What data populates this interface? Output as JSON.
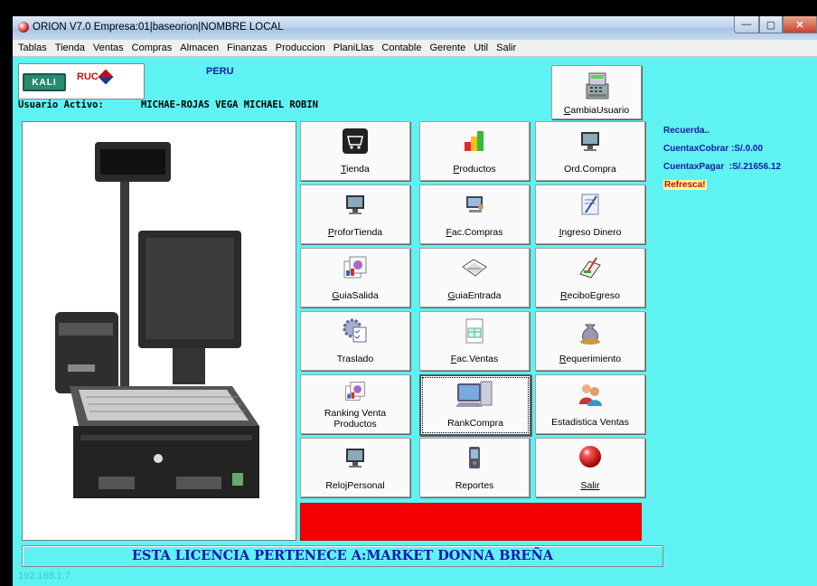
{
  "window": {
    "title": "ORION V7.0 Empresa:01|baseorion|NOMBRE LOCAL"
  },
  "menu": [
    "Tablas",
    "Tienda",
    "Ventas",
    "Compras",
    "Almacen",
    "Finanzas",
    "Produccion",
    "PlaniLlas",
    "Contable",
    "Gerente",
    "Util",
    "Salir"
  ],
  "header": {
    "kali_logo": "KALI",
    "ruc_logo": "RUC",
    "country": "PERU",
    "user_label": "Usuario Activo:",
    "user_name": "MICHAE-ROJAS VEGA MICHAEL ROBIN",
    "cambia_usuario": "CambiaUsuario"
  },
  "tiles": {
    "tienda": "Tienda",
    "productos": "Productos",
    "ord_compra": "Ord.Compra",
    "profor_tienda": "ProforTienda",
    "fac_compras": "Fac.Compras",
    "ingreso_dinero": "Ingreso Dinero",
    "guia_salida": "GuiaSalida",
    "guia_entrada": "GuiaEntrada",
    "recibo_egreso": "ReciboEgreso",
    "traslado": "Traslado",
    "fac_ventas": "Fac.Ventas",
    "requerimiento": "Requerimiento",
    "ranking_venta_1": "Ranking Venta",
    "ranking_venta_2": "Productos",
    "rank_compra": "RankCompra",
    "estadistica_ventas": "Estadistica Ventas",
    "reloj_personal": "RelojPersonal",
    "reportes": "Reportes",
    "salir": "Salir"
  },
  "side_panel": {
    "recuerda": "Recuerda..",
    "cuentas_cobrar": "CuentaxCobrar :S/.0.00",
    "cuentas_pagar": "CuentaxPagar  :S/.21656.12",
    "refresca": "Refresca!"
  },
  "license": "ESTA LICENCIA PERTENECE A:MARKET DONNA BREÑA",
  "ip": "192.168.1.7",
  "colors": {
    "background": "#5ff2f2",
    "license_text": "#1616b0",
    "alert_bar": "#f50000"
  }
}
